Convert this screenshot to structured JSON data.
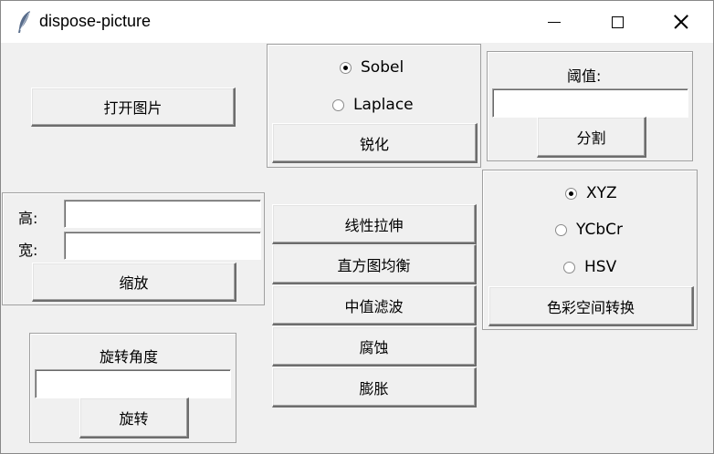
{
  "window": {
    "title": "dispose-picture",
    "icon": "feather-icon"
  },
  "open_button": "打开图片",
  "edge": {
    "options": [
      {
        "label": "Sobel",
        "selected": true
      },
      {
        "label": "Laplace",
        "selected": false
      }
    ],
    "sharpen_button": "锐化"
  },
  "threshold": {
    "label": "阈值:",
    "value": "",
    "split_button": "分割"
  },
  "resize": {
    "height_label": "高:",
    "width_label": "宽:",
    "height_value": "",
    "width_value": "",
    "scale_button": "缩放"
  },
  "operations": [
    "线性拉伸",
    "直方图均衡",
    "中值滤波",
    "腐蚀",
    "膨胀"
  ],
  "color_space": {
    "options": [
      {
        "label": "XYZ",
        "selected": true
      },
      {
        "label": "YCbCr",
        "selected": false
      },
      {
        "label": "HSV",
        "selected": false
      }
    ],
    "convert_button": "色彩空间转换"
  },
  "rotate": {
    "label": "旋转角度",
    "value": "",
    "rotate_button": "旋转"
  }
}
